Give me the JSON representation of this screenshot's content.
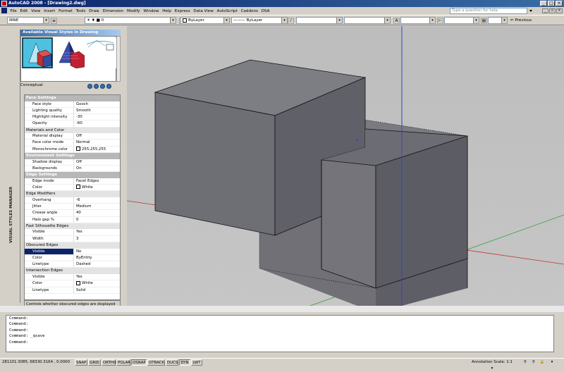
{
  "window": {
    "title": "AutoCAD 2008 - [Drawing2.dwg]"
  },
  "menu": [
    "File",
    "Edit",
    "View",
    "Insert",
    "Format",
    "Tools",
    "Draw",
    "Dimension",
    "Modify",
    "Window",
    "Help",
    "Express",
    "Data View",
    "AutoScript",
    "Caddons",
    "DSA"
  ],
  "help": {
    "placeholder": "Type a question for help"
  },
  "toolbar": {
    "workspace": "IRNE",
    "layer": "0",
    "color": "ByLayer",
    "linetype": "ByLayer",
    "previous_label": "Previous"
  },
  "panel": {
    "side_title": "VISUAL STYLES MANAGER",
    "header": "Available Visual Styles in Drawing",
    "current_style": "Conceptual",
    "sections": [
      {
        "title": "Face Settings",
        "type": "main",
        "rows": [
          {
            "k": "Face style",
            "v": "Gooch"
          },
          {
            "k": "Lighting quality",
            "v": "Smooth"
          },
          {
            "k": "Highlight intensity",
            "v": "-30"
          },
          {
            "k": "Opacity",
            "v": "-60"
          }
        ]
      },
      {
        "title": "Materials and Color",
        "type": "sub",
        "rows": [
          {
            "k": "Material display",
            "v": "Off"
          },
          {
            "k": "Face color mode",
            "v": "Normal"
          },
          {
            "k": "Monochrome color",
            "v": "255,255,255",
            "swatch": "#ffffff"
          }
        ]
      },
      {
        "title": "Environment Settings",
        "type": "main",
        "rows": [
          {
            "k": "Shadow display",
            "v": "Off"
          },
          {
            "k": "Backgrounds",
            "v": "On"
          }
        ]
      },
      {
        "title": "Edge Settings",
        "type": "main",
        "rows": [
          {
            "k": "Edge mode",
            "v": "Facet Edges"
          },
          {
            "k": "Color",
            "v": "White",
            "swatch": "#ffffff"
          }
        ]
      },
      {
        "title": "Edge Modifiers",
        "type": "sub",
        "rows": [
          {
            "k": "Overhang",
            "v": "-6"
          },
          {
            "k": "Jitter",
            "v": "Medium"
          },
          {
            "k": "Crease angle",
            "v": "40"
          },
          {
            "k": "Halo gap %",
            "v": "0"
          }
        ]
      },
      {
        "title": "Fast Silhouette Edges",
        "type": "sub",
        "rows": [
          {
            "k": "Visible",
            "v": "Yes"
          },
          {
            "k": "Width",
            "v": "3"
          }
        ]
      },
      {
        "title": "Obscured Edges",
        "type": "sub",
        "rows": [
          {
            "k": "Visible",
            "v": "No",
            "selected": true
          },
          {
            "k": "Color",
            "v": "ByEntity"
          },
          {
            "k": "Linetype",
            "v": "Dashed"
          }
        ]
      },
      {
        "title": "Intersection Edges",
        "type": "sub",
        "rows": [
          {
            "k": "Visible",
            "v": "Yes"
          },
          {
            "k": "Color",
            "v": "White",
            "swatch": "#ffffff"
          },
          {
            "k": "Linetype",
            "v": "Solid"
          }
        ]
      }
    ],
    "description": "Controls whether obscured edges are displayed (VSOBSCUREDEDGES system variable)"
  },
  "command_lines": [
    "Command:",
    "Command:",
    "Command:",
    "Command: _qsave",
    "Command:"
  ],
  "status": {
    "coords": "281101.3085, 68330.3164 , 0.0000",
    "toggles": [
      {
        "label": "SNAP",
        "on": false
      },
      {
        "label": "GRID",
        "on": false
      },
      {
        "label": "ORTHO",
        "on": false
      },
      {
        "label": "POLAR",
        "on": false
      },
      {
        "label": "OSNAP",
        "on": true
      },
      {
        "label": "OTRACK",
        "on": false
      },
      {
        "label": "DUCS",
        "on": false
      },
      {
        "label": "DYN",
        "on": true
      },
      {
        "label": "LWT",
        "on": false
      }
    ],
    "annotation_scale": "Annotation Scale: 1:1 ▾"
  },
  "colors": {
    "cube_top": "#78787c",
    "cube_front": "#6f6f74",
    "cube_side": "#5c5c62",
    "viewport_bg": "#c0c0c0",
    "accent": "#0a246a"
  }
}
